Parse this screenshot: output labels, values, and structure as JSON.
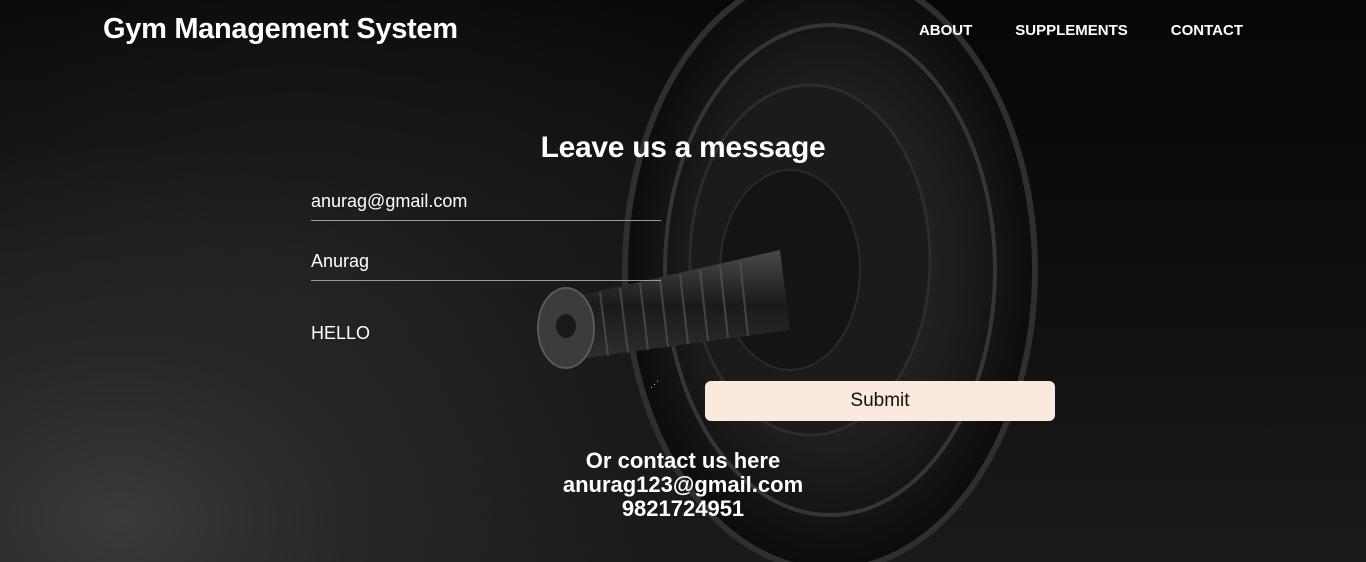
{
  "header": {
    "brand": "Gym Management System",
    "nav": [
      {
        "label": "ABOUT"
      },
      {
        "label": "SUPPLEMENTS"
      },
      {
        "label": "CONTACT"
      }
    ]
  },
  "form": {
    "title": "Leave us a message",
    "email_value": "anurag@gmail.com",
    "name_value": "Anurag",
    "message_value": "HELLO",
    "submit_label": "Submit"
  },
  "contact": {
    "heading": "Or contact us here",
    "email": "anurag123@gmail.com",
    "phone": "9821724951"
  },
  "colors": {
    "background": "#000000",
    "text": "#ffffff",
    "submit_bg": "#fae9dc",
    "submit_text": "#111111"
  },
  "background_image": "dumbbell-plate-image"
}
